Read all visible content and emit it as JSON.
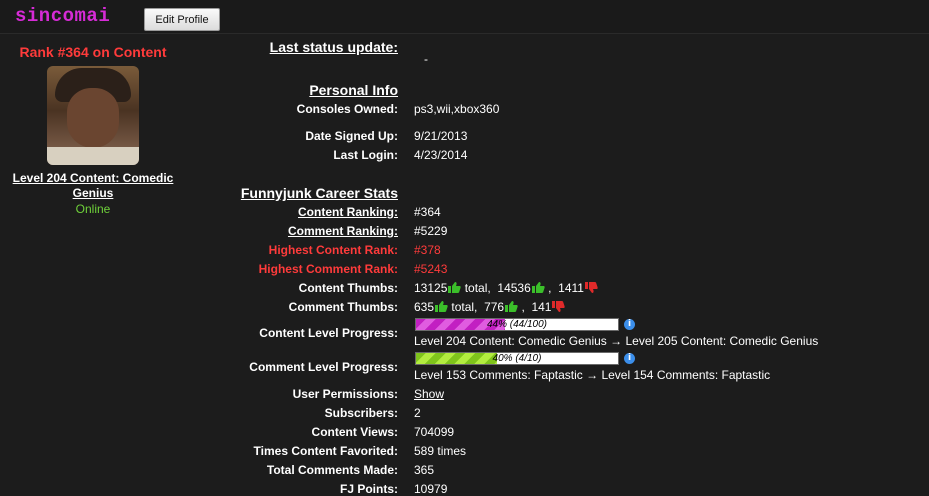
{
  "header": {
    "username": "sincomai",
    "edit_button": "Edit Profile"
  },
  "sidebar": {
    "rank_title": "Rank #364 on Content",
    "level_link": "Level 204 Content: Comedic Genius",
    "status": "Online"
  },
  "status_update": {
    "label": "Last status update:",
    "value": "-"
  },
  "personal_info": {
    "heading": "Personal Info",
    "consoles_label": "Consoles Owned:",
    "consoles_value": "ps3,wii,xbox360",
    "signed_label": "Date Signed Up:",
    "signed_value": "9/21/2013",
    "login_label": "Last Login:",
    "login_value": "4/23/2014"
  },
  "career": {
    "heading": "Funnyjunk Career Stats",
    "content_ranking_label": "Content Ranking:",
    "content_ranking_value": "#364",
    "comment_ranking_label": "Comment Ranking:",
    "comment_ranking_value": "#5229",
    "highest_content_label": "Highest Content Rank:",
    "highest_content_value": "#378",
    "highest_comment_label": "Highest Comment Rank:",
    "highest_comment_value": "#5243",
    "content_thumbs": {
      "label": "Content Thumbs:",
      "total": "13125",
      "total_suffix": " total,",
      "up": "14536",
      "sep": ",",
      "down": "1411"
    },
    "comment_thumbs": {
      "label": "Comment Thumbs:",
      "total": "635",
      "total_suffix": " total,",
      "up": "776",
      "sep": ",",
      "down": "141"
    },
    "content_progress": {
      "label": "Content Level Progress:",
      "percent": 44,
      "bar_text": "44% (44/100)",
      "from": "Level 204 Content: Comedic Genius",
      "arrow": "→",
      "to": "Level 205 Content: Comedic Genius",
      "color": "#c21fc2"
    },
    "comment_progress": {
      "label": "Comment Level Progress:",
      "percent": 40,
      "bar_text": "40% (4/10)",
      "from": "Level 153 Comments: Faptastic",
      "arrow": "→",
      "to": "Level 154 Comments: Faptastic",
      "color": "#7fc41b"
    },
    "permissions_label": "User Permissions:",
    "permissions_value": "Show",
    "subscribers_label": "Subscribers:",
    "subscribers_value": "2",
    "views_label": "Content Views:",
    "views_value": "704099",
    "favorited_label": "Times Content Favorited:",
    "favorited_value": "589 times",
    "comments_label": "Total Comments Made:",
    "comments_value": "365",
    "points_label": "FJ Points:",
    "points_value": "10979"
  }
}
